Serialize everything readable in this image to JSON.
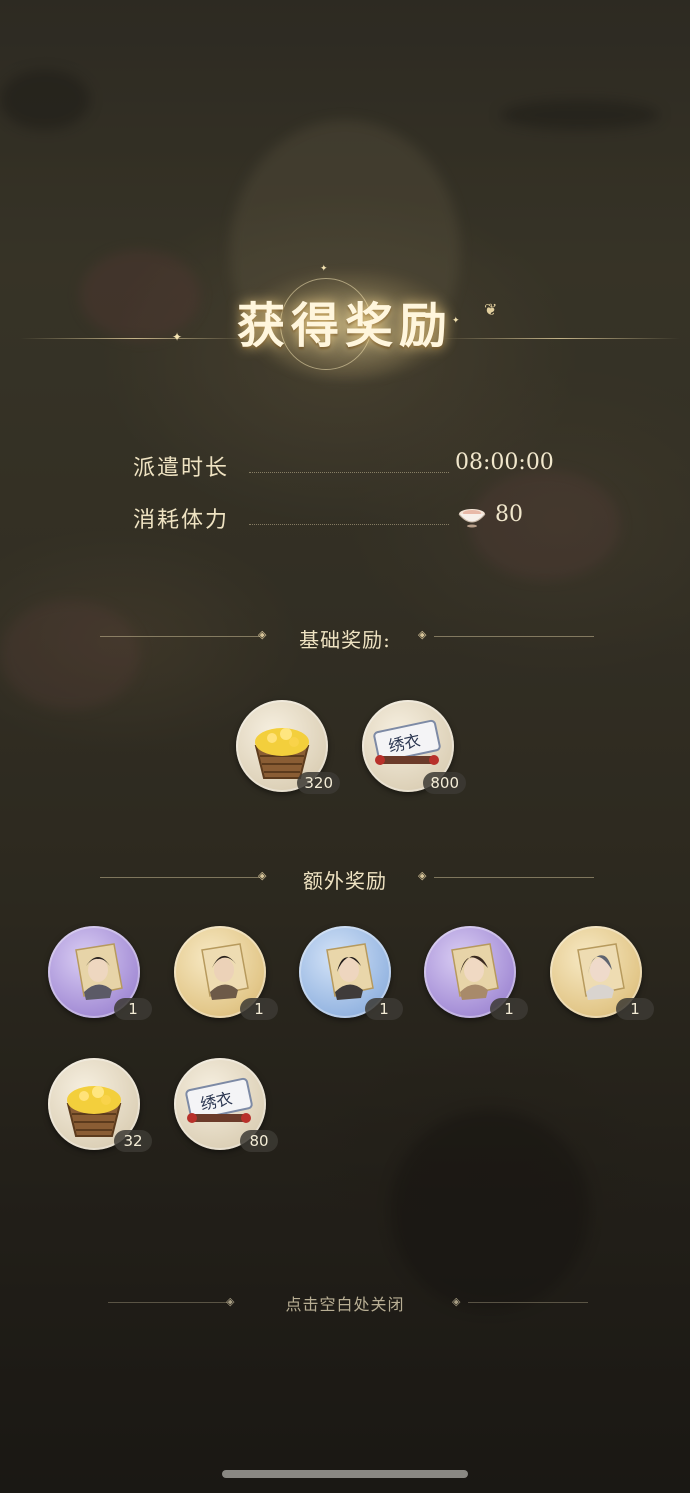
{
  "title": "获得奖励",
  "info": {
    "duration_label": "派遣时长",
    "duration_value": "08:00:00",
    "stamina_label": "消耗体力",
    "stamina_value": "80"
  },
  "basic_rewards": {
    "header": "基础奖励:",
    "items": [
      {
        "icon": "gold-basket-icon",
        "count": "320"
      },
      {
        "icon": "embroidery-scroll-icon",
        "count": "800"
      }
    ]
  },
  "extra_rewards": {
    "header": "额外奖励",
    "items": [
      {
        "icon": "character-portrait-icon",
        "rarity_color": "#a892d8",
        "count": "1"
      },
      {
        "icon": "character-portrait-icon",
        "rarity_color": "#e3c88b",
        "count": "1"
      },
      {
        "icon": "character-portrait-icon",
        "rarity_color": "#9ab9e3",
        "count": "1"
      },
      {
        "icon": "character-portrait-icon",
        "rarity_color": "#a892d8",
        "count": "1"
      },
      {
        "icon": "character-portrait-icon",
        "rarity_color": "#e3c88b",
        "count": "1"
      },
      {
        "icon": "gold-basket-icon",
        "count": "32"
      },
      {
        "icon": "embroidery-scroll-icon",
        "count": "80"
      }
    ]
  },
  "scroll_text": "绣衣",
  "close_hint": "点击空白处关闭",
  "colors": {
    "text_gold": "#efe3c2",
    "badge_bg": "#3c3a34"
  }
}
